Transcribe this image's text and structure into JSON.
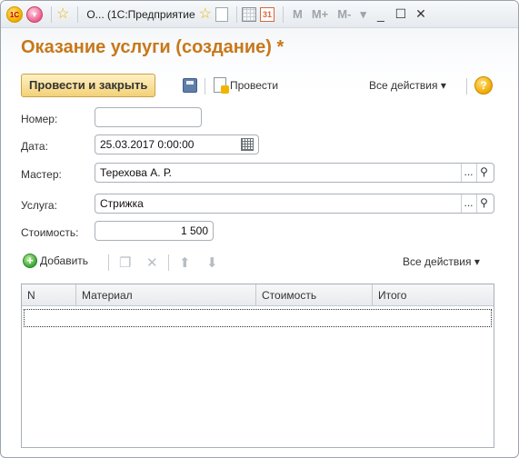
{
  "titlebar": {
    "logo_text": "1С",
    "title": "О... (1С:Предприятие",
    "m_buttons": [
      "M",
      "M+",
      "M-"
    ],
    "window_controls": [
      "_",
      "☐",
      "✕"
    ]
  },
  "form": {
    "title": "Оказание услуги (создание) *"
  },
  "toolbar": {
    "post_close_label": "Провести и закрыть",
    "post_label": "Провести",
    "all_actions_label": "Все действия",
    "help_label": "?"
  },
  "fields": {
    "number": {
      "label": "Номер:",
      "value": ""
    },
    "date": {
      "label": "Дата:",
      "value": "25.03.2017  0:00:00"
    },
    "master": {
      "label": "Мастер:",
      "value": "Терехова А. Р."
    },
    "service": {
      "label": "Услуга:",
      "value": "Стрижка"
    },
    "cost": {
      "label": "Стоимость:",
      "value": "1 500"
    }
  },
  "table_toolbar": {
    "add_label": "Добавить",
    "all_actions_label": "Все действия"
  },
  "table": {
    "columns": [
      "N",
      "Материал",
      "Стоимость",
      "Итого"
    ]
  },
  "icons": {
    "logo": "1c-logo-icon",
    "back": "back-icon",
    "favorite": "star-icon",
    "save": "save-icon",
    "help": "help-icon",
    "add": "add-icon"
  },
  "colors": {
    "title": "#c7781a",
    "primary_button": "#f3d177"
  }
}
